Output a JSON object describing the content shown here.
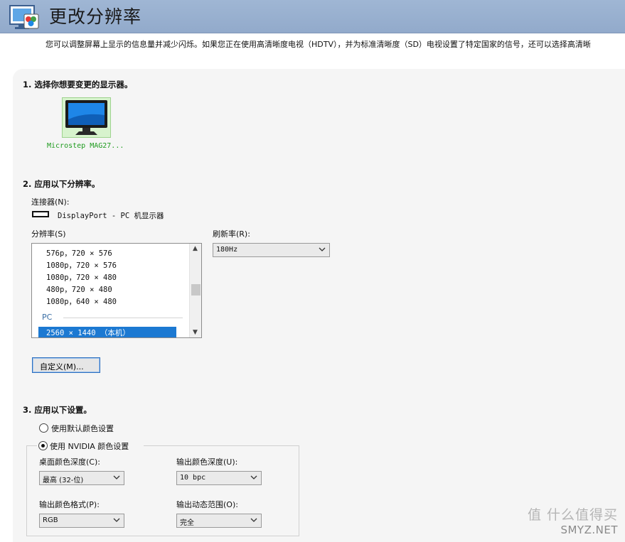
{
  "header": {
    "title": "更改分辨率",
    "icon": "display-settings-icon"
  },
  "description": "您可以调整屏幕上显示的信息量并减少闪烁。如果您正在使用高清晰度电视（HDTV），并为标准清晰度（SD）电视设置了特定国家的信号，还可以选择高清晰",
  "section1": {
    "title": "1. 选择你想要变更的显示器。",
    "monitor_label": "Microstep MAG27..."
  },
  "section2": {
    "title": "2. 应用以下分辨率。",
    "connector_label": "连接器(N):",
    "connector_value": "DisplayPort - PC 机显示器",
    "resolution_label": "分辨率(S)",
    "refresh_label": "刷新率(R):",
    "refresh_value": "180Hz",
    "resolutions": [
      "576p，720 × 576",
      "1080p，720 × 576",
      "1080p，720 × 480",
      "480p，720 × 480",
      "1080p，640 × 480"
    ],
    "group_pc": "PC",
    "selected_resolution": "2560 × 1440 （本机）",
    "custom_button": "自定义(M)..."
  },
  "section3": {
    "title": "3. 应用以下设置。",
    "radio_default": "使用默认颜色设置",
    "radio_nvidia": "使用 NVIDIA 颜色设置",
    "desktop_depth_label": "桌面颜色深度(C):",
    "desktop_depth_value": "最高 (32-位)",
    "output_depth_label": "输出颜色深度(U):",
    "output_depth_value": "10 bpc",
    "output_format_label": "输出颜色格式(P):",
    "output_format_value": "RGB",
    "output_range_label": "输出动态范围(O):",
    "output_range_value": "完全"
  },
  "watermark": {
    "top": "值 什么值得买",
    "bottom": "SMYZ.NET"
  }
}
